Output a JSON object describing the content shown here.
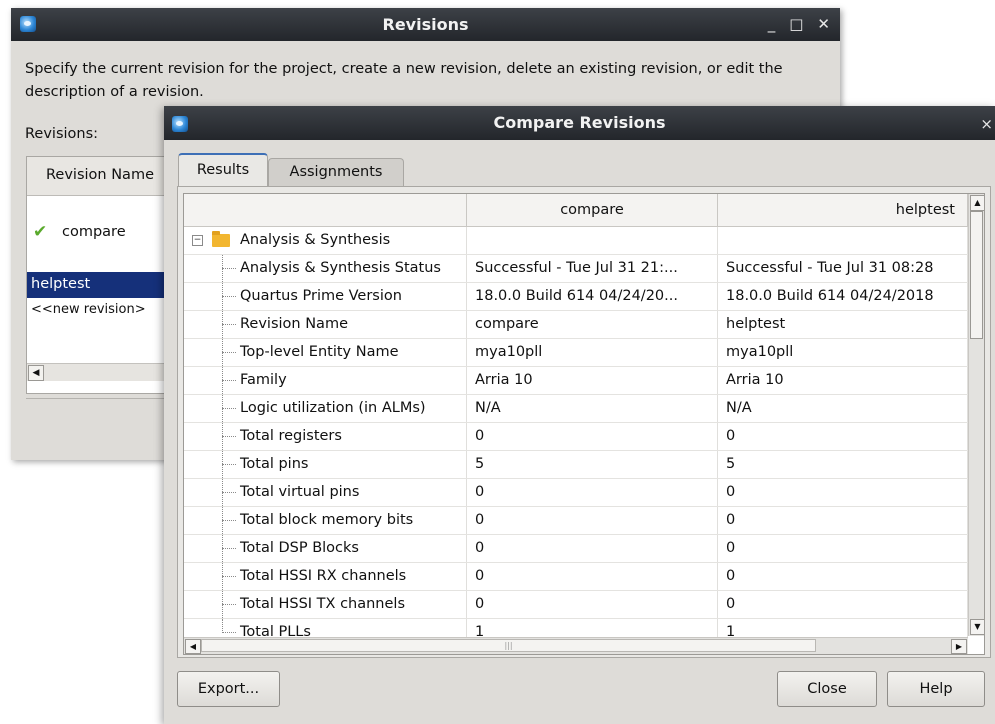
{
  "revisions_window": {
    "title": "Revisions",
    "controls": {
      "minimize": "_",
      "maximize": "□",
      "close": "✕"
    },
    "description": "Specify the current revision for the project, create a new revision, delete an existing revision, or edit the description of a revision.",
    "revisions_label": "Revisions:",
    "table": {
      "column_header": "Revision Name",
      "rows": [
        {
          "name": "compare",
          "current": true
        },
        {
          "name": "helptest",
          "selected": true
        },
        {
          "name": "<<new revision>"
        }
      ]
    }
  },
  "compare_window": {
    "title": "Compare Revisions",
    "close": "×",
    "tabs": [
      {
        "label": "Results",
        "active": true
      },
      {
        "label": "Assignments",
        "active": false
      }
    ],
    "columns": [
      "",
      "compare",
      "helptest"
    ],
    "group": {
      "label": "Analysis & Synthesis",
      "expander": "−"
    },
    "rows": [
      {
        "name": "Analysis & Synthesis Status",
        "compare": "Successful - Tue Jul 31 21:...",
        "helptest": "Successful - Tue Jul 31 08:28"
      },
      {
        "name": "Quartus Prime Version",
        "compare": "18.0.0 Build 614 04/24/20...",
        "helptest": "18.0.0 Build 614 04/24/2018"
      },
      {
        "name": "Revision Name",
        "compare": "compare",
        "helptest": "helptest"
      },
      {
        "name": "Top-level Entity Name",
        "compare": "mya10pll",
        "helptest": "mya10pll"
      },
      {
        "name": "Family",
        "compare": "Arria 10",
        "helptest": "Arria 10"
      },
      {
        "name": "Logic utilization (in ALMs)",
        "compare": "N/A",
        "helptest": "N/A"
      },
      {
        "name": "Total registers",
        "compare": "0",
        "helptest": "0"
      },
      {
        "name": "Total pins",
        "compare": "5",
        "helptest": "5"
      },
      {
        "name": "Total virtual pins",
        "compare": "0",
        "helptest": "0"
      },
      {
        "name": "Total block memory bits",
        "compare": "0",
        "helptest": "0"
      },
      {
        "name": "Total DSP Blocks",
        "compare": "0",
        "helptest": "0"
      },
      {
        "name": "Total HSSI RX channels",
        "compare": "0",
        "helptest": "0"
      },
      {
        "name": "Total HSSI TX channels",
        "compare": "0",
        "helptest": "0"
      },
      {
        "name": "Total PLLs",
        "compare": "1",
        "helptest": "1"
      }
    ],
    "buttons": {
      "export": "Export...",
      "close": "Close",
      "help": "Help"
    },
    "colors": {
      "titlebar": "#2e3136",
      "selection": "#15307a",
      "check": "#5aaa2c",
      "folder": "#f2b630"
    }
  }
}
